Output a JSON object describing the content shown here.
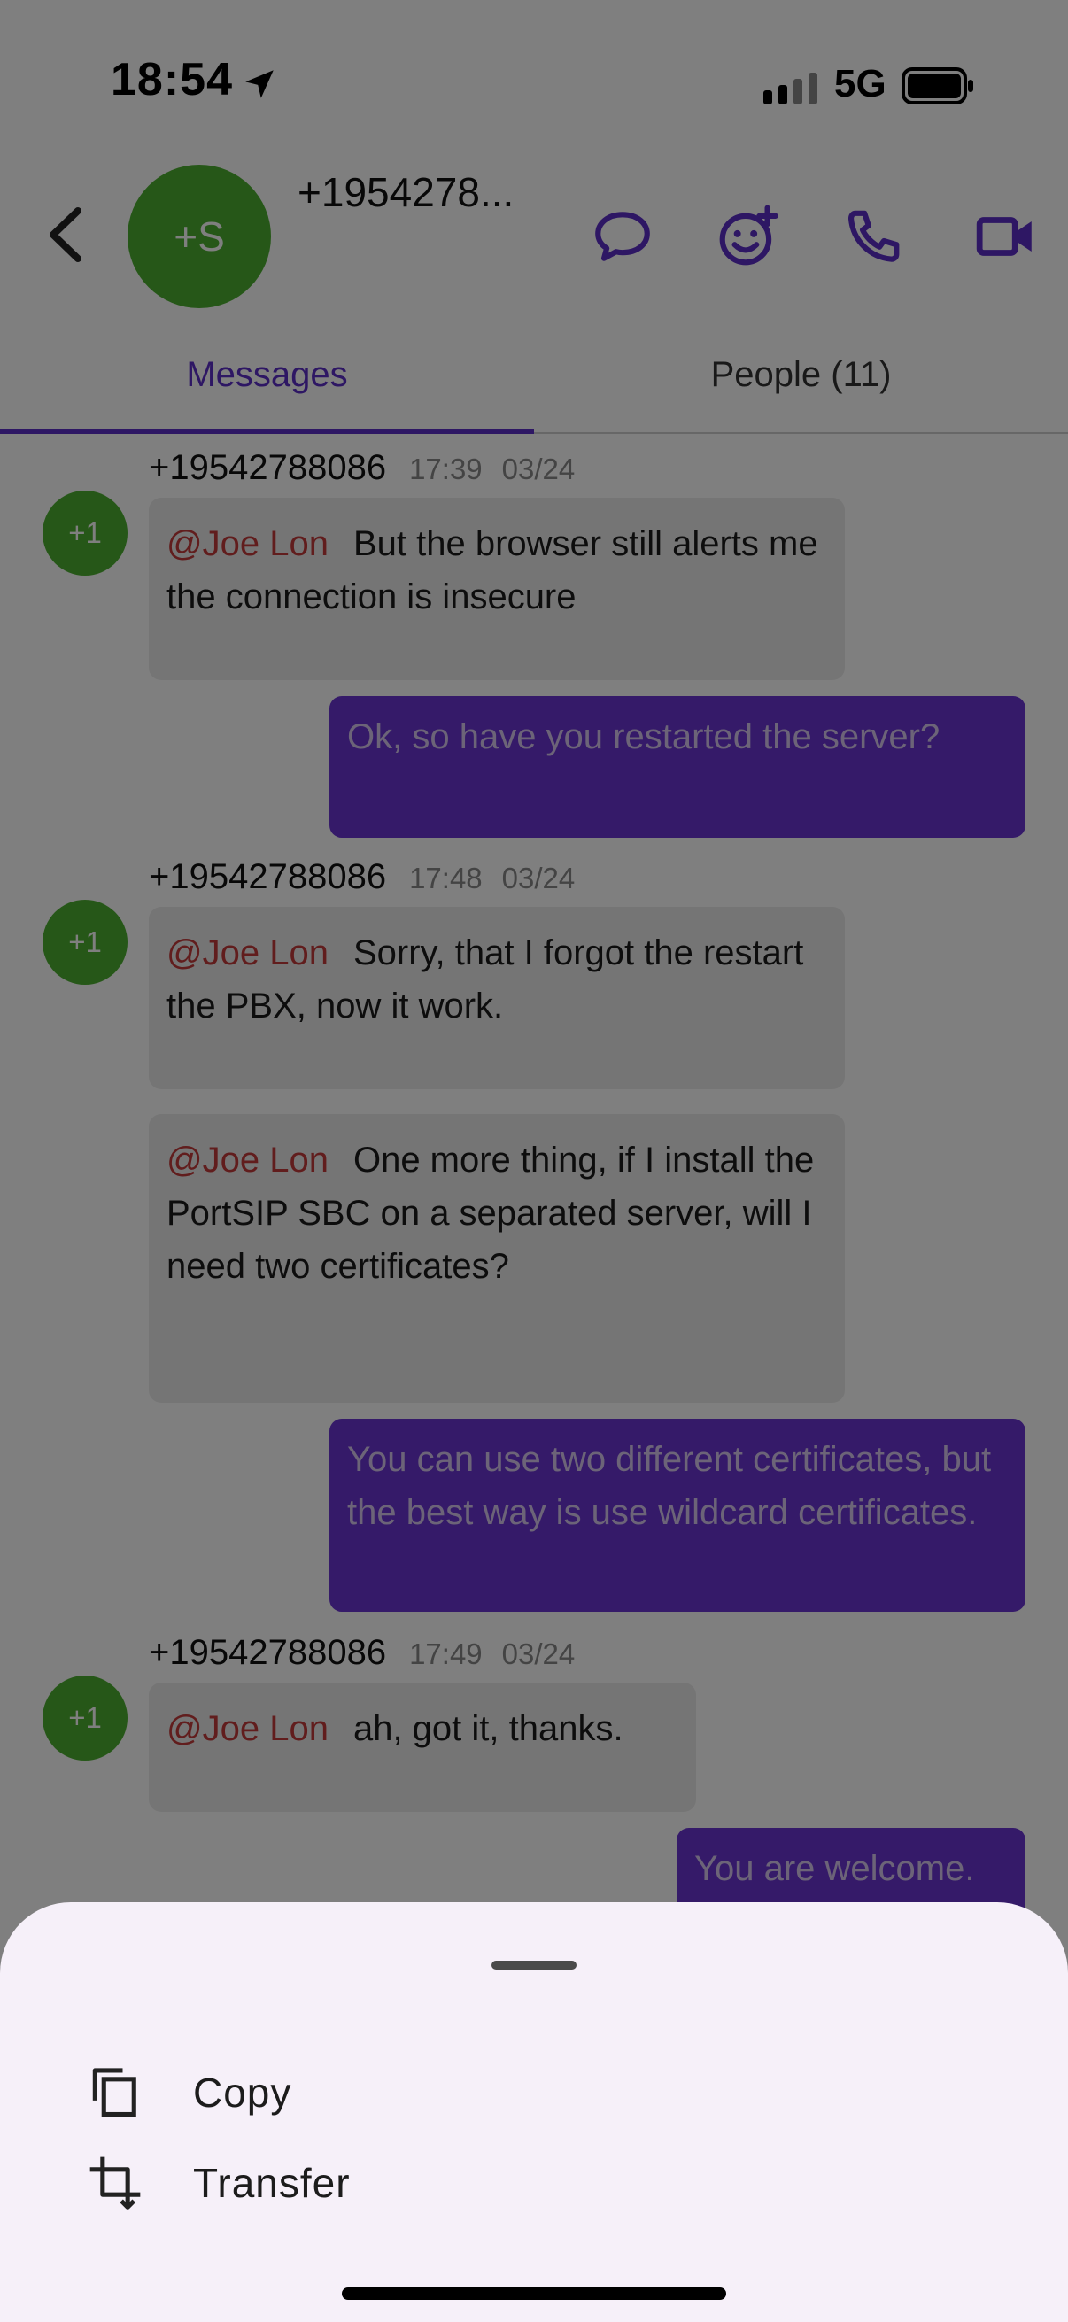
{
  "status_bar": {
    "time": "18:54",
    "network": "5G"
  },
  "header": {
    "title": "+1954278...",
    "avatar_initials": "+S",
    "icons": [
      "chat-bubble-icon",
      "add-emoji-icon",
      "phone-icon",
      "video-camera-icon"
    ]
  },
  "tabs": [
    {
      "label": "Messages",
      "active": true
    },
    {
      "label": "People (11)",
      "active": false
    }
  ],
  "messages": [
    {
      "direction": "in",
      "sender": "+19542788086",
      "time": "17:39",
      "date": "03/24",
      "avatar": "+1",
      "mention": "@Joe Lon",
      "text": "But the browser still alerts me the connection is insecure"
    },
    {
      "direction": "out",
      "text": "Ok, so have you restarted the server?"
    },
    {
      "direction": "in",
      "sender": "+19542788086",
      "time": "17:48",
      "date": "03/24",
      "avatar": "+1",
      "mention": "@Joe Lon",
      "text": "Sorry, that I forgot the restart the PBX, now it work."
    },
    {
      "direction": "in",
      "mention": "@Joe Lon",
      "text": "One more thing, if I install the PortSIP SBC on a separated server, will I need two certificates?"
    },
    {
      "direction": "out",
      "text": "You can use two different certificates, but the best way is use wildcard certificates."
    },
    {
      "direction": "in",
      "sender": "+19542788086",
      "time": "17:49",
      "date": "03/24",
      "avatar": "+1",
      "mention": "@Joe Lon",
      "text": "ah, got it, thanks."
    },
    {
      "direction": "out",
      "text": "You are welcome."
    }
  ],
  "bottom_sheet": {
    "items": [
      {
        "label": "Copy",
        "icon": "copy-icon"
      },
      {
        "label": "Transfer",
        "icon": "crop-transfer-icon"
      }
    ]
  },
  "colors": {
    "accent": "#5c2ec8",
    "avatar_green": "#4caf30",
    "outgoing_bubble": "#6a35d2",
    "incoming_bubble": "#ebebeb",
    "mention": "#c23b3b",
    "sheet_bg": "#f6f0f9"
  }
}
